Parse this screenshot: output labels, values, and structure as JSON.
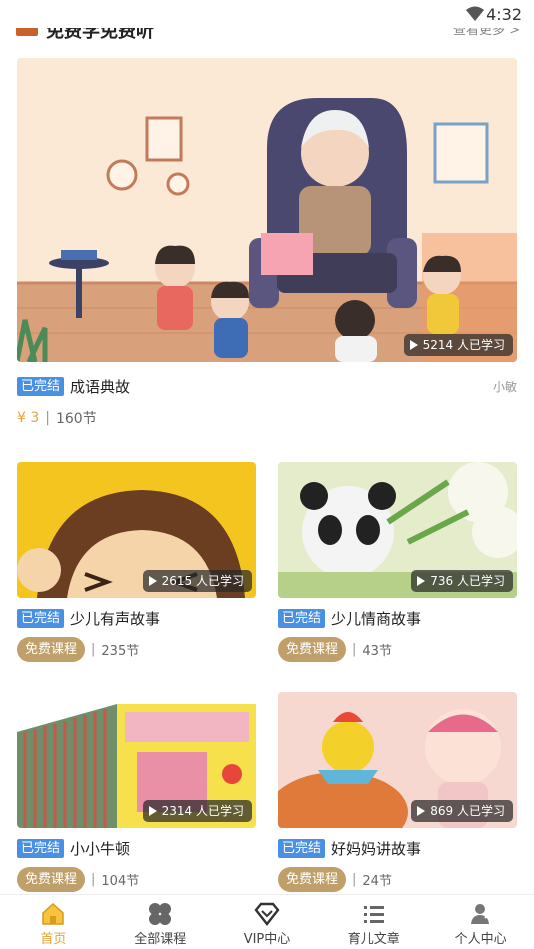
{
  "status_bar": {
    "time": "4:32"
  },
  "section": {
    "title": "免费学免费听",
    "more": "查看更多 >"
  },
  "featured": {
    "count": "5214 人已学习",
    "tag": "已完结",
    "title": "成语典故",
    "author": "小敏",
    "price": "¥ 3",
    "lessons": "160节"
  },
  "cards": [
    {
      "count": "2615 人已学习",
      "tag": "已完结",
      "title": "少儿有声故事",
      "pill": "免费课程",
      "lessons": "235节"
    },
    {
      "count": "736 人已学习",
      "tag": "已完结",
      "title": "少儿情商故事",
      "pill": "免费课程",
      "lessons": "43节"
    },
    {
      "count": "2314 人已学习",
      "tag": "已完结",
      "title": "小小牛顿",
      "pill": "免费课程",
      "lessons": "104节"
    },
    {
      "count": "869 人已学习",
      "tag": "已完结",
      "title": "好妈妈讲故事",
      "pill": "免费课程",
      "lessons": "24节"
    }
  ],
  "nav": [
    {
      "label": "首页",
      "icon": "home-icon",
      "active": true
    },
    {
      "label": "全部课程",
      "icon": "clover-icon",
      "active": false
    },
    {
      "label": "VIP中心",
      "icon": "diamond-icon",
      "active": false
    },
    {
      "label": "育儿文章",
      "icon": "list-icon",
      "active": false
    },
    {
      "label": "个人中心",
      "icon": "user-icon",
      "active": false
    }
  ],
  "colors": {
    "accent": "#e8a33c",
    "tag_blue": "#4a90e2",
    "pill_gold": "#bfa06a"
  }
}
